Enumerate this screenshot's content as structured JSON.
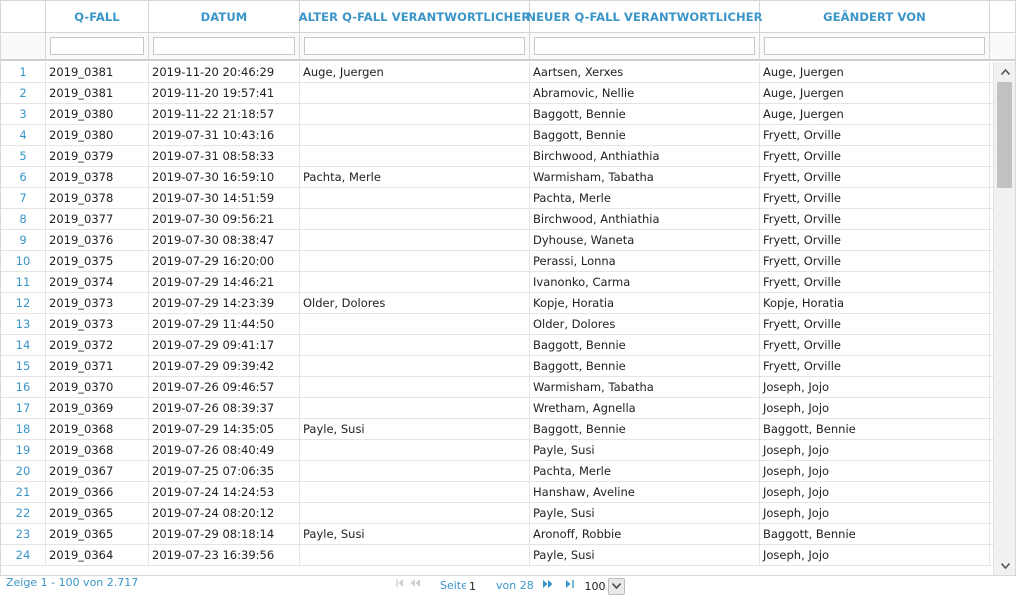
{
  "columns": [
    "Q-FALL",
    "DATUM",
    "ALTER Q-FALL VERANTWORTLICHER",
    "NEUER Q-FALL VERANTWORTLICHER",
    "GEÄNDERT VON"
  ],
  "filters": [
    "",
    "",
    "",
    "",
    ""
  ],
  "rows": [
    {
      "n": "1",
      "qfall": "2019_0381",
      "datum": "2019-11-20 20:46:29",
      "alter": "Auge, Juergen",
      "neuer": "Aartsen, Xerxes",
      "geaendert": "Auge, Juergen"
    },
    {
      "n": "2",
      "qfall": "2019_0381",
      "datum": "2019-11-20 19:57:41",
      "alter": "",
      "neuer": "Abramovic, Nellie",
      "geaendert": "Auge, Juergen"
    },
    {
      "n": "3",
      "qfall": "2019_0380",
      "datum": "2019-11-22 21:18:57",
      "alter": "",
      "neuer": "Baggott, Bennie",
      "geaendert": "Auge, Juergen"
    },
    {
      "n": "4",
      "qfall": "2019_0380",
      "datum": "2019-07-31 10:43:16",
      "alter": "",
      "neuer": "Baggott, Bennie",
      "geaendert": "Fryett, Orville"
    },
    {
      "n": "5",
      "qfall": "2019_0379",
      "datum": "2019-07-31 08:58:33",
      "alter": "",
      "neuer": "Birchwood, Anthiathia",
      "geaendert": "Fryett, Orville"
    },
    {
      "n": "6",
      "qfall": "2019_0378",
      "datum": "2019-07-30 16:59:10",
      "alter": "Pachta, Merle",
      "neuer": "Warmisham, Tabatha",
      "geaendert": "Fryett, Orville"
    },
    {
      "n": "7",
      "qfall": "2019_0378",
      "datum": "2019-07-30 14:51:59",
      "alter": "",
      "neuer": "Pachta, Merle",
      "geaendert": "Fryett, Orville"
    },
    {
      "n": "8",
      "qfall": "2019_0377",
      "datum": "2019-07-30 09:56:21",
      "alter": "",
      "neuer": "Birchwood, Anthiathia",
      "geaendert": "Fryett, Orville"
    },
    {
      "n": "9",
      "qfall": "2019_0376",
      "datum": "2019-07-30 08:38:47",
      "alter": "",
      "neuer": "Dyhouse, Waneta",
      "geaendert": "Fryett, Orville"
    },
    {
      "n": "10",
      "qfall": "2019_0375",
      "datum": "2019-07-29 16:20:00",
      "alter": "",
      "neuer": "Perassi, Lonna",
      "geaendert": "Fryett, Orville"
    },
    {
      "n": "11",
      "qfall": "2019_0374",
      "datum": "2019-07-29 14:46:21",
      "alter": "",
      "neuer": "Ivanonko, Carma",
      "geaendert": "Fryett, Orville"
    },
    {
      "n": "12",
      "qfall": "2019_0373",
      "datum": "2019-07-29 14:23:39",
      "alter": "Older, Dolores",
      "neuer": "Kopje, Horatia",
      "geaendert": "Kopje, Horatia"
    },
    {
      "n": "13",
      "qfall": "2019_0373",
      "datum": "2019-07-29 11:44:50",
      "alter": "",
      "neuer": "Older, Dolores",
      "geaendert": "Fryett, Orville"
    },
    {
      "n": "14",
      "qfall": "2019_0372",
      "datum": "2019-07-29 09:41:17",
      "alter": "",
      "neuer": "Baggott, Bennie",
      "geaendert": "Fryett, Orville"
    },
    {
      "n": "15",
      "qfall": "2019_0371",
      "datum": "2019-07-29 09:39:42",
      "alter": "",
      "neuer": "Baggott, Bennie",
      "geaendert": "Fryett, Orville"
    },
    {
      "n": "16",
      "qfall": "2019_0370",
      "datum": "2019-07-26 09:46:57",
      "alter": "",
      "neuer": "Warmisham, Tabatha",
      "geaendert": "Joseph, Jojo"
    },
    {
      "n": "17",
      "qfall": "2019_0369",
      "datum": "2019-07-26 08:39:37",
      "alter": "",
      "neuer": "Wretham, Agnella",
      "geaendert": "Joseph, Jojo"
    },
    {
      "n": "18",
      "qfall": "2019_0368",
      "datum": "2019-07-29 14:35:05",
      "alter": "Payle, Susi",
      "neuer": "Baggott, Bennie",
      "geaendert": "Baggott, Bennie"
    },
    {
      "n": "19",
      "qfall": "2019_0368",
      "datum": "2019-07-26 08:40:49",
      "alter": "",
      "neuer": "Payle, Susi",
      "geaendert": "Joseph, Jojo"
    },
    {
      "n": "20",
      "qfall": "2019_0367",
      "datum": "2019-07-25 07:06:35",
      "alter": "",
      "neuer": "Pachta, Merle",
      "geaendert": "Joseph, Jojo"
    },
    {
      "n": "21",
      "qfall": "2019_0366",
      "datum": "2019-07-24 14:24:53",
      "alter": "",
      "neuer": "Hanshaw, Aveline",
      "geaendert": "Joseph, Jojo"
    },
    {
      "n": "22",
      "qfall": "2019_0365",
      "datum": "2019-07-24 08:20:12",
      "alter": "",
      "neuer": "Payle, Susi",
      "geaendert": "Joseph, Jojo"
    },
    {
      "n": "23",
      "qfall": "2019_0365",
      "datum": "2019-07-29 08:18:14",
      "alter": "Payle, Susi",
      "neuer": "Aronoff, Robbie",
      "geaendert": "Baggott, Bennie"
    },
    {
      "n": "24",
      "qfall": "2019_0364",
      "datum": "2019-07-23 16:39:56",
      "alter": "",
      "neuer": "Payle, Susi",
      "geaendert": "Joseph, Jojo"
    }
  ],
  "pager": {
    "info": "Zeige 1 - 100 von 2.717",
    "page_label": "Seite",
    "page_value": "1",
    "of_label": "von 28",
    "page_size": "100"
  },
  "icons": {
    "scroll_up": "chevron-up-icon",
    "scroll_down": "chevron-down-icon",
    "first": "first-page-icon",
    "prev": "prev-page-icon",
    "next": "next-page-icon",
    "last": "last-page-icon",
    "dropdown": "chevron-down-icon"
  },
  "colors": {
    "accent": "#3a95c8",
    "disabled": "#cccccc"
  }
}
